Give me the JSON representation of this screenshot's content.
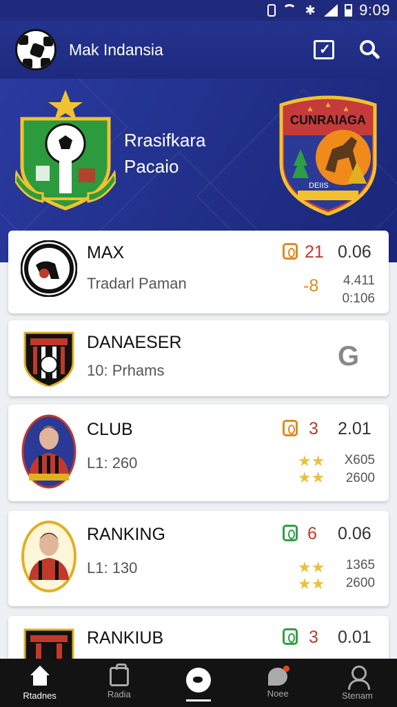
{
  "status_bar": {
    "time": "9:09"
  },
  "app_bar": {
    "title": "Mak Indansia"
  },
  "hero": {
    "title_line1": "Rrasifkara",
    "title_line2": "Pacaio",
    "right_crest_text": "CUNRAIAGA",
    "right_crest_subtext": "DEIIS"
  },
  "cards": [
    {
      "name": "MAX",
      "sub": "Tradarl Paman",
      "count": "21",
      "rate": "0.06",
      "orange_num": "-8",
      "small1": "4.411",
      "small2": "0:106"
    },
    {
      "name": "DANAESER",
      "sub": "10: Prhams",
      "g_icon": "G"
    },
    {
      "name": "CLUB",
      "sub": "L1: 260",
      "count": "3",
      "rate": "2.01",
      "small1": "X605",
      "small2": "2600"
    },
    {
      "name": "RANKING",
      "sub": "L1: 130",
      "count": "6",
      "rate": "0.06",
      "small1": "1365",
      "small2": "2600"
    },
    {
      "name": "RANKIUB",
      "count": "3",
      "rate": "0.01"
    }
  ],
  "bottom_nav": [
    {
      "label": "Rtadnes",
      "icon": "home-icon"
    },
    {
      "label": "Radia",
      "icon": "bag-icon"
    },
    {
      "label": "",
      "icon": "ball-icon"
    },
    {
      "label": "Noee",
      "icon": "chat-icon"
    },
    {
      "label": "Stenam",
      "icon": "user-icon"
    }
  ],
  "colors": {
    "primary": "#24338f",
    "accent_red": "#c0392b",
    "accent_orange": "#e08a1e",
    "nav_bg": "#131313"
  }
}
